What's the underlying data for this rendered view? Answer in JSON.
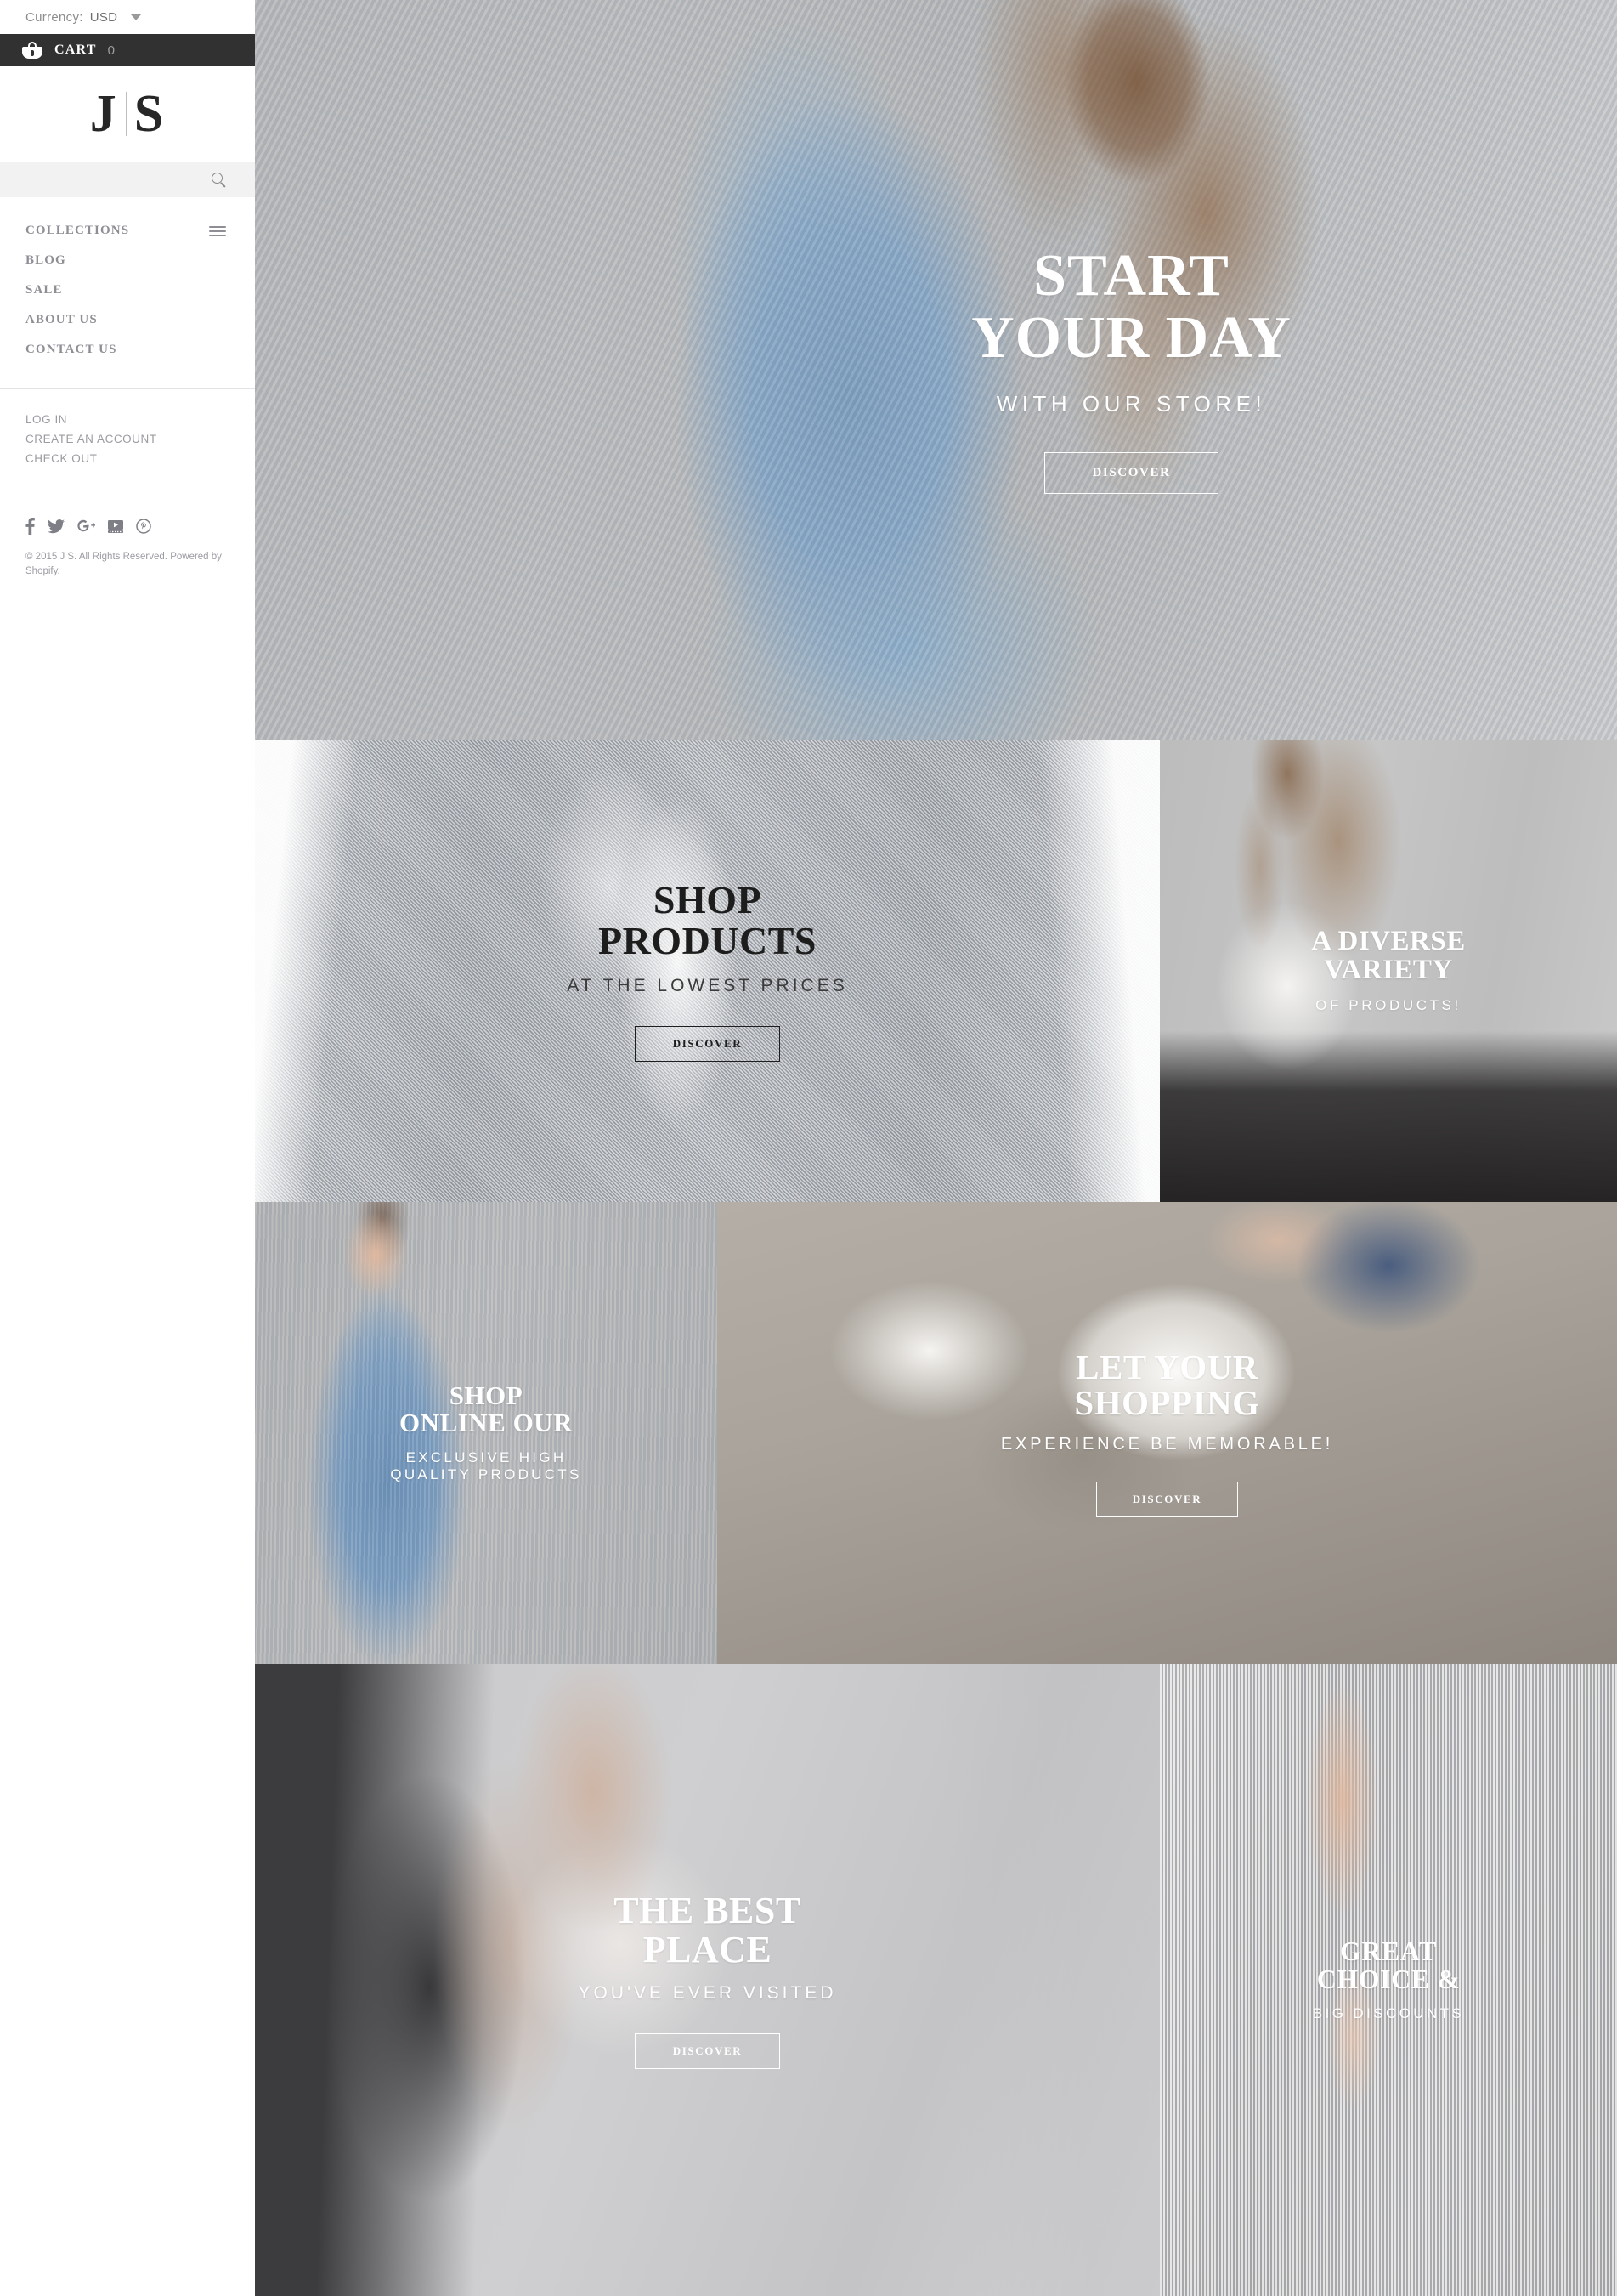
{
  "topbar": {
    "currency_label": "Currency:",
    "currency_value": "USD",
    "cart_label": "CART",
    "cart_count": "0"
  },
  "logo": {
    "left": "J",
    "right": "S"
  },
  "search": {
    "value": "",
    "placeholder": ""
  },
  "main_menu": [
    {
      "label": "COLLECTIONS",
      "has_burger": true
    },
    {
      "label": "BLOG",
      "has_burger": false
    },
    {
      "label": "SALE",
      "has_burger": false
    },
    {
      "label": "ABOUT US",
      "has_burger": false
    },
    {
      "label": "CONTACT US",
      "has_burger": false
    }
  ],
  "account_menu": [
    {
      "label": "LOG IN"
    },
    {
      "label": "CREATE AN ACCOUNT"
    },
    {
      "label": "CHECK OUT"
    }
  ],
  "social": [
    {
      "name": "facebook"
    },
    {
      "name": "twitter"
    },
    {
      "name": "google-plus"
    },
    {
      "name": "youtube"
    },
    {
      "name": "pinterest"
    }
  ],
  "copyright": "© 2015 J S. All Rights Reserved. Powered by Shopify.",
  "panels": {
    "hero": {
      "title_line1": "START",
      "title_line2": "YOUR DAY",
      "subtitle": "WITH OUR STORE!",
      "button": "DISCOVER"
    },
    "shop_products": {
      "title_line1": "SHOP",
      "title_line2": "PRODUCTS",
      "subtitle": "AT THE LOWEST PRICES",
      "button": "DISCOVER"
    },
    "diverse_variety": {
      "title_line1": "A DIVERSE",
      "title_line2": "VARIETY",
      "subtitle": "OF PRODUCTS!"
    },
    "shop_online": {
      "title_line1": "SHOP",
      "title_line2": "ONLINE OUR",
      "subtitle_line1": "EXCLUSIVE HIGH",
      "subtitle_line2": "QUALITY PRODUCTS"
    },
    "let_your_shopping": {
      "title_line1": "LET YOUR",
      "title_line2": "SHOPPING",
      "subtitle": "EXPERIENCE BE MEMORABLE!",
      "button": "DISCOVER"
    },
    "best_place": {
      "title_line1": "THE BEST",
      "title_line2": "PLACE",
      "subtitle": "YOU'VE EVER VISITED",
      "button": "DISCOVER"
    },
    "great_choice": {
      "title_line1": "GREAT",
      "title_line2": "CHOICE &",
      "subtitle": "BIG DISCOUNTS"
    }
  },
  "colors": {
    "cart_bar": "#313131",
    "menu_text": "#8e8e95",
    "accent_dark": "#1d1d1d",
    "light_text": "#ffffff"
  }
}
